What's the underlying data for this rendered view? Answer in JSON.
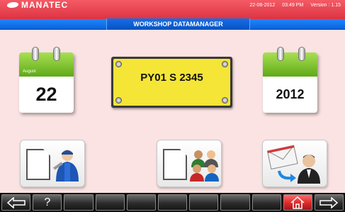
{
  "header": {
    "brand": "MANATEC",
    "date": "22-08-2012",
    "time": "03:49 PM",
    "version": "Version : 1.15"
  },
  "title": "WORKSHOP DATAMANAGER",
  "calendar_day": {
    "month": "August",
    "day": "22"
  },
  "calendar_year": {
    "year": "2012"
  },
  "plate": {
    "number": "PY01 S 2345"
  },
  "tiles": [
    {
      "name": "technician-document-icon"
    },
    {
      "name": "customers-document-icon"
    },
    {
      "name": "email-user-icon"
    }
  ],
  "bottom": {
    "help": "?",
    "colors": {
      "home": "#d92a2a",
      "bar": "#111111"
    }
  }
}
